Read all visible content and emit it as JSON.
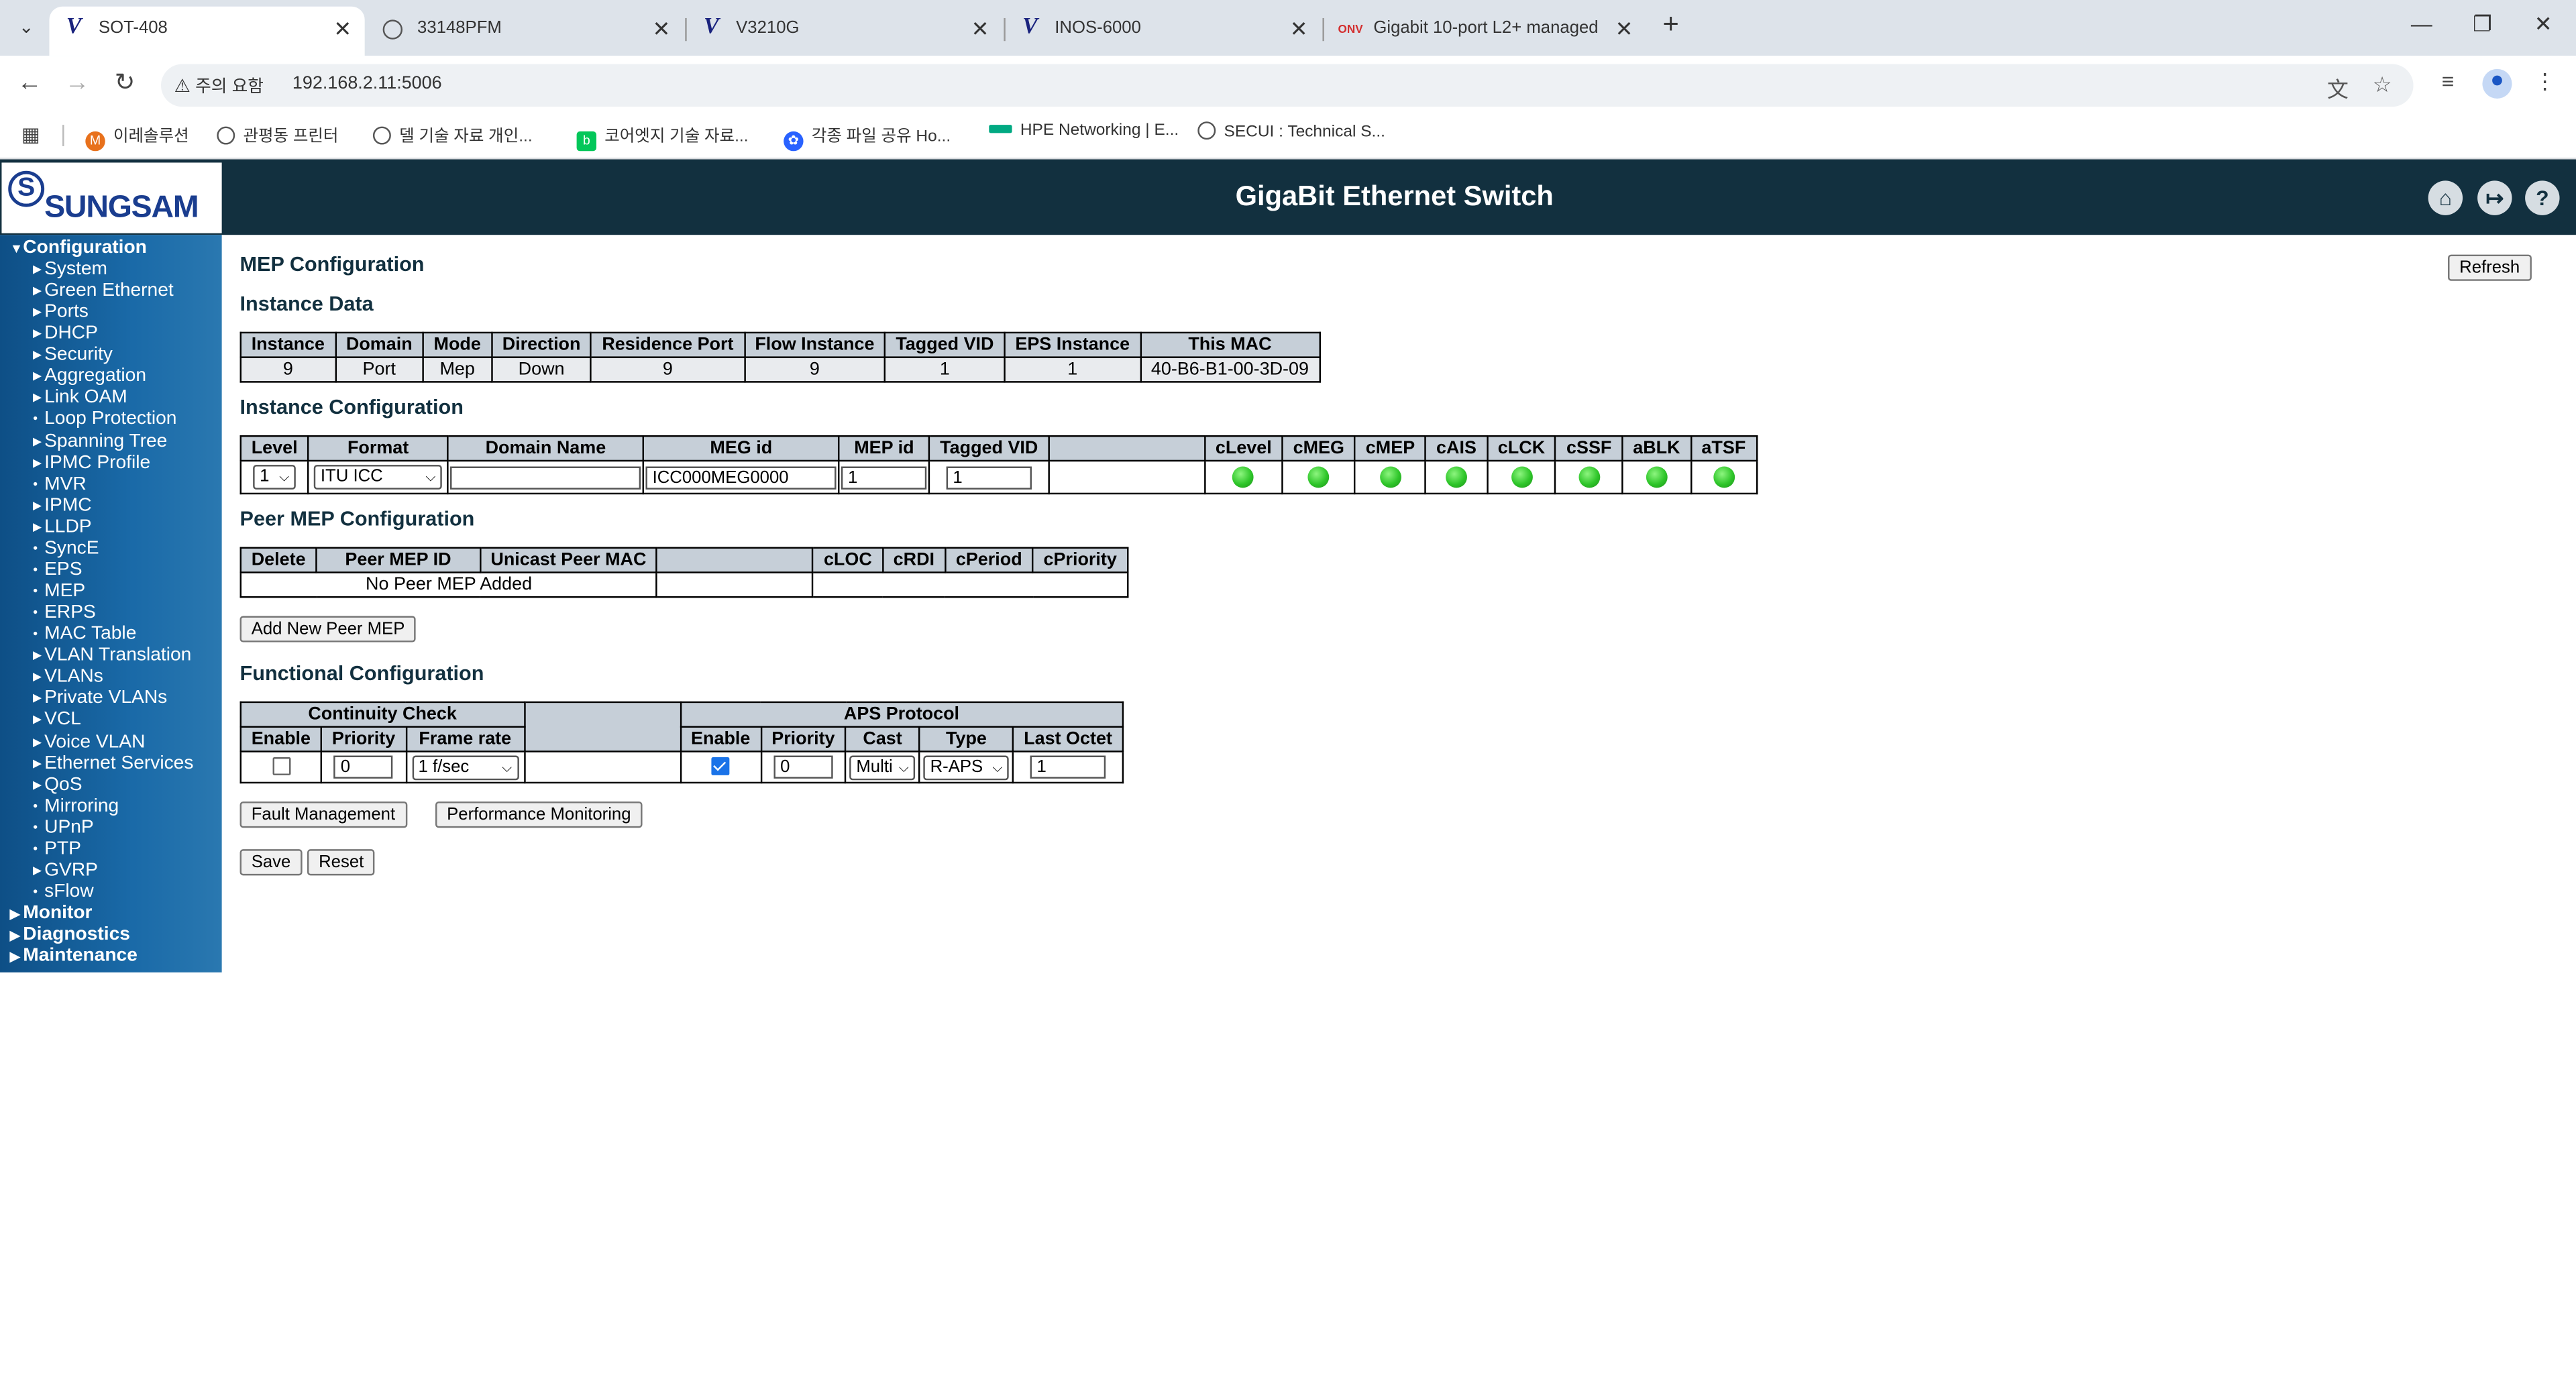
{
  "browser": {
    "tabs": [
      {
        "title": "SOT-408",
        "active": true
      },
      {
        "title": "33148PFM",
        "active": false
      },
      {
        "title": "V3210G",
        "active": false
      },
      {
        "title": "INOS-6000",
        "active": false
      },
      {
        "title": "Gigabit 10-port L2+ managed",
        "active": false
      }
    ],
    "security_warning": "주의 요함",
    "url": "192.168.2.11:5006",
    "bookmarks": [
      "이레솔루션",
      "관평동 프린터",
      "델 기술 자료 개인...",
      "코어엣지 기술 자료...",
      "각종 파일 공유 Ho...",
      "HPE Networking | E...",
      "SECUI : Technical S..."
    ]
  },
  "app": {
    "logo_text": "SUNGSAM",
    "title": "GigaBit Ethernet Switch"
  },
  "sidebar": {
    "configuration": "Configuration",
    "items": [
      {
        "label": "System",
        "type": "folder"
      },
      {
        "label": "Green Ethernet",
        "type": "folder"
      },
      {
        "label": "Ports",
        "type": "folder"
      },
      {
        "label": "DHCP",
        "type": "folder"
      },
      {
        "label": "Security",
        "type": "folder"
      },
      {
        "label": "Aggregation",
        "type": "folder"
      },
      {
        "label": "Link OAM",
        "type": "folder"
      },
      {
        "label": "Loop Protection",
        "type": "page"
      },
      {
        "label": "Spanning Tree",
        "type": "folder"
      },
      {
        "label": "IPMC Profile",
        "type": "folder"
      },
      {
        "label": "MVR",
        "type": "page"
      },
      {
        "label": "IPMC",
        "type": "folder"
      },
      {
        "label": "LLDP",
        "type": "folder"
      },
      {
        "label": "SyncE",
        "type": "page"
      },
      {
        "label": "EPS",
        "type": "page"
      },
      {
        "label": "MEP",
        "type": "page"
      },
      {
        "label": "ERPS",
        "type": "page"
      },
      {
        "label": "MAC Table",
        "type": "page"
      },
      {
        "label": "VLAN Translation",
        "type": "folder"
      },
      {
        "label": "VLANs",
        "type": "folder"
      },
      {
        "label": "Private VLANs",
        "type": "folder"
      },
      {
        "label": "VCL",
        "type": "folder"
      },
      {
        "label": "Voice VLAN",
        "type": "folder"
      },
      {
        "label": "Ethernet Services",
        "type": "folder"
      },
      {
        "label": "QoS",
        "type": "folder"
      },
      {
        "label": "Mirroring",
        "type": "page"
      },
      {
        "label": "UPnP",
        "type": "page"
      },
      {
        "label": "PTP",
        "type": "page"
      },
      {
        "label": "GVRP",
        "type": "folder"
      },
      {
        "label": "sFlow",
        "type": "page"
      }
    ],
    "monitor": "Monitor",
    "diagnostics": "Diagnostics",
    "maintenance": "Maintenance"
  },
  "page": {
    "title": "MEP Configuration",
    "refresh_label": "Refresh",
    "instance_data": {
      "heading": "Instance Data",
      "headers": [
        "Instance",
        "Domain",
        "Mode",
        "Direction",
        "Residence Port",
        "Flow Instance",
        "Tagged VID",
        "EPS Instance",
        "This MAC"
      ],
      "row": [
        "9",
        "Port",
        "Mep",
        "Down",
        "9",
        "9",
        "1",
        "1",
        "40-B6-B1-00-3D-09"
      ]
    },
    "instance_config": {
      "heading": "Instance Configuration",
      "headers": [
        "Level",
        "Format",
        "Domain Name",
        "MEG id",
        "MEP id",
        "Tagged VID",
        "",
        "cLevel",
        "cMEG",
        "cMEP",
        "cAIS",
        "cLCK",
        "cSSF",
        "aBLK",
        "aTSF"
      ],
      "level": "1",
      "format": "ITU ICC",
      "domain_name": "",
      "meg_id": "ICC000MEG0000",
      "mep_id": "1",
      "tagged_vid": "1",
      "led_color": "#2fc62a"
    },
    "peer_mep": {
      "heading": "Peer MEP Configuration",
      "headers": [
        "Delete",
        "Peer MEP ID",
        "Unicast Peer MAC",
        "",
        "cLOC",
        "cRDI",
        "cPeriod",
        "cPriority"
      ],
      "empty_text": "No Peer MEP Added",
      "add_label": "Add New Peer MEP"
    },
    "functional": {
      "heading": "Functional Configuration",
      "group_cc": "Continuity Check",
      "group_aps": "APS Protocol",
      "headers": [
        "Enable",
        "Priority",
        "Frame rate",
        "Enable",
        "Priority",
        "Cast",
        "Type",
        "Last Octet"
      ],
      "cc_enable": false,
      "cc_priority": "0",
      "cc_frame_rate": "1 f/sec",
      "aps_enable": true,
      "aps_priority": "0",
      "aps_cast": "Multi",
      "aps_type": "R-APS",
      "aps_last_octet": "1"
    },
    "fault_label": "Fault Management",
    "perf_label": "Performance Monitoring",
    "save_label": "Save",
    "reset_label": "Reset"
  }
}
